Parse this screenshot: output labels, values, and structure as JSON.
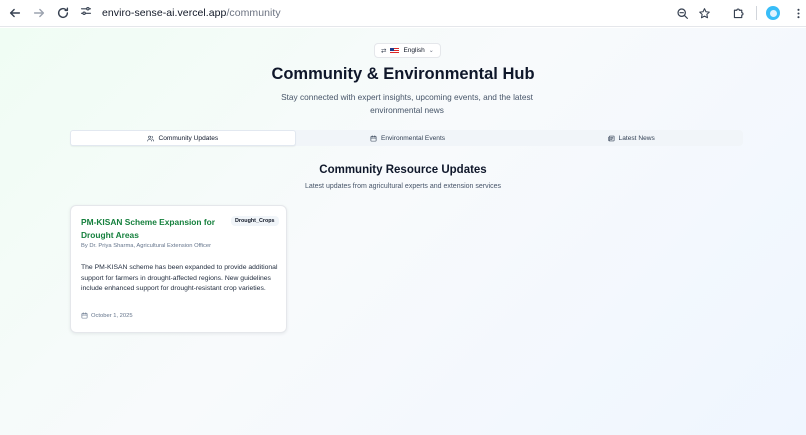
{
  "browser": {
    "url_host": "enviro-sense-ai.vercel.app",
    "url_path": "/community"
  },
  "language": {
    "label": "English",
    "flag": "🇺🇸"
  },
  "header": {
    "title": "Community & Environmental Hub",
    "subtitle": "Stay connected with expert insights, upcoming events, and the latest environmental news"
  },
  "tabs": [
    {
      "label": "Community Updates",
      "icon": "users-icon",
      "active": true
    },
    {
      "label": "Environmental Events",
      "icon": "calendar-icon",
      "active": false
    },
    {
      "label": "Latest News",
      "icon": "newspaper-icon",
      "active": false
    }
  ],
  "section": {
    "title": "Community Resource Updates",
    "subtitle": "Latest updates from agricultural experts and extension services"
  },
  "cards": [
    {
      "title": "PM-KISAN Scheme Expansion for Drought Areas",
      "badge": "Drought_Crops",
      "author": "By Dr. Priya Sharma, Agricultural Extension Officer",
      "body": "The PM-KISAN scheme has been expanded to provide additional support for farmers in drought-affected regions. New guidelines include enhanced support for drought-resistant crop varieties.",
      "date": "October 1, 2025"
    }
  ],
  "colors": {
    "accent_green": "#15803d",
    "background_start": "#f0fdf4",
    "background_end": "#eff6ff"
  }
}
